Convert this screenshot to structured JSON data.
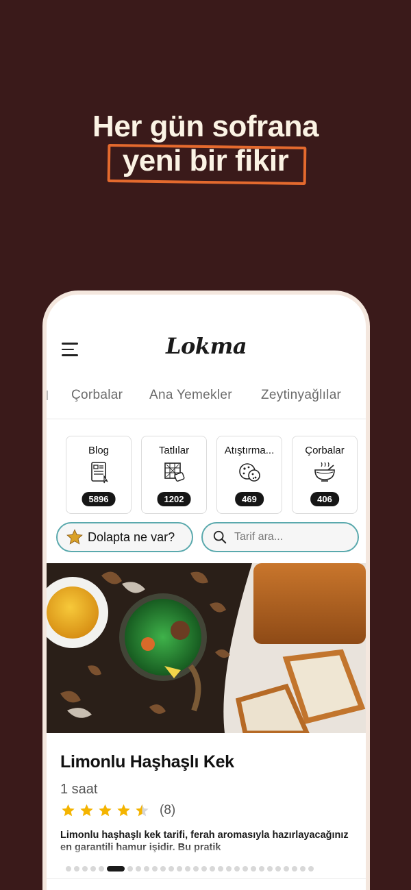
{
  "headline": {
    "line1": "Her gün sofrana",
    "line2": "yeni bir fikir"
  },
  "app": {
    "logo": "Lokma",
    "menu_icon": "hamburger-menu-icon"
  },
  "category_tabs": [
    {
      "label": "Çorbalar"
    },
    {
      "label": "Ana Yemekler"
    },
    {
      "label": "Zeytinyağlılar"
    }
  ],
  "tiles": [
    {
      "label": "Blog",
      "count": "5896",
      "icon": "blog-document-icon"
    },
    {
      "label": "Tatlılar",
      "count": "1202",
      "icon": "dessert-tray-icon"
    },
    {
      "label": "Atıştırma...",
      "count": "469",
      "icon": "cookies-icon"
    },
    {
      "label": "Çorbalar",
      "count": "406",
      "icon": "soup-bowl-icon"
    }
  ],
  "fridge_button": {
    "label": "Dolapta ne var?",
    "icon": "star-icon"
  },
  "search": {
    "placeholder": "Tarif ara...",
    "value": ""
  },
  "featured": {
    "title": "Limonlu Haşhaşlı Kek",
    "duration": "1 saat",
    "rating": 4.5,
    "rating_count": "(8)",
    "description": "Limonlu haşhaşlı kek tarifi, ferah aromasıyla hazırlayacağınız en garantili hamur işidir. Bu pratik"
  },
  "carousel": {
    "total": 29,
    "active": 5
  },
  "colors": {
    "background": "#3a1a1a",
    "headline_text": "#fbf3e4",
    "accent_frame": "#e46a2e",
    "pill_border": "#5aa9ad",
    "star": "#f4b400"
  }
}
